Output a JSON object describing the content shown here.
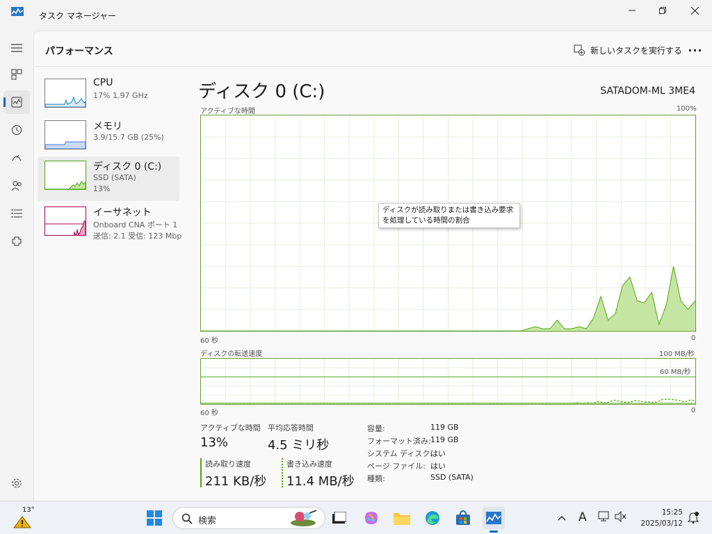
{
  "window": {
    "title": "タスク マネージャー",
    "controls": [
      "minimize",
      "restore",
      "close"
    ]
  },
  "header": {
    "page_title": "パフォーマンス",
    "run_task_label": "新しいタスクを実行する",
    "more_icon": "more-icon"
  },
  "nav": {
    "items": [
      "hamburger-icon",
      "processes-icon",
      "performance-icon",
      "app-history-icon",
      "startup-apps-icon",
      "users-icon",
      "details-icon",
      "services-icon"
    ],
    "settings": "settings-icon",
    "active": "performance-icon"
  },
  "resources": [
    {
      "name": "CPU",
      "line1": "17%  1.97 GHz",
      "line2": "",
      "color": "#117dbb"
    },
    {
      "name": "メモリ",
      "line1": "3.9/15.7 GB (25%)",
      "line2": "",
      "color": "#3c78d8"
    },
    {
      "name": "ディスク 0 (C:)",
      "line1": "SSD (SATA)",
      "line2": "13%",
      "color": "#4da60c"
    },
    {
      "name": "イーサネット",
      "line1": "Onboard CNA ポート 1",
      "line2": "送信: 2.1  受信: 123 Mbp",
      "color": "#a7004e"
    }
  ],
  "disk": {
    "title": "ディスク 0 (C:)",
    "model": "SATADOM-ML 3ME4",
    "active_graph": {
      "label": "アクティブな時間",
      "max_label": "100%",
      "time_left": "60 秒",
      "time_right": "0",
      "values_percent": [
        0,
        0,
        0,
        0,
        0,
        0,
        0,
        0,
        0,
        0,
        0,
        0,
        0,
        0,
        0,
        0,
        0,
        0,
        0,
        0,
        0,
        0,
        0,
        0,
        0,
        0,
        0,
        0,
        0,
        0,
        0,
        0,
        0,
        0,
        0,
        0,
        0,
        0,
        0,
        0,
        0,
        0,
        0,
        0,
        0,
        1,
        2,
        1,
        1,
        5,
        1,
        1,
        2,
        1,
        6,
        16,
        5,
        8,
        21,
        25,
        14,
        13,
        18,
        3,
        12,
        30,
        14,
        10,
        14
      ],
      "tooltip": "ディスクが読み取りまたは書き込み要求を処理している時間の割合"
    },
    "transfer_graph": {
      "label": "ディスクの転送速度",
      "max_label": "100 MB/秒",
      "ref_label": "60 MB/秒",
      "time_left": "60 秒",
      "time_right": "0",
      "read_values_mbps": [
        0,
        0,
        0,
        0,
        0,
        0,
        0,
        0,
        0,
        0,
        0,
        0,
        0,
        0,
        0,
        0,
        0,
        0,
        0,
        0,
        0,
        0,
        0,
        0,
        0,
        0,
        0,
        0,
        0,
        0,
        0,
        0,
        0,
        0,
        0,
        0,
        0,
        0,
        0,
        0,
        0,
        0,
        0,
        0,
        0,
        0,
        0,
        0,
        0,
        0,
        0,
        0,
        0,
        0,
        0,
        0,
        0,
        0,
        0,
        0,
        0,
        0,
        0,
        0,
        0,
        0,
        0,
        0,
        0,
        0,
        0,
        0,
        0,
        0,
        0,
        0,
        0,
        0,
        0,
        0,
        0,
        0,
        0,
        0,
        0,
        0,
        0,
        0,
        0,
        0,
        0,
        0,
        0
      ],
      "write_values_mbps": [
        0,
        0,
        0,
        0,
        0,
        0,
        0,
        0,
        0,
        0,
        0,
        0,
        0,
        0,
        0,
        0,
        0,
        0,
        0,
        0,
        0,
        0,
        0,
        0,
        0,
        0,
        0,
        0,
        0,
        0,
        0,
        0,
        0,
        0,
        0,
        0,
        0,
        0,
        0,
        0,
        0,
        0,
        0,
        0,
        0,
        0,
        0,
        0,
        0,
        0,
        0,
        0,
        0,
        0,
        0,
        0,
        0,
        0,
        0,
        0,
        0,
        0,
        0,
        0,
        0,
        0,
        0,
        0,
        0,
        0,
        1,
        0,
        1,
        0,
        4,
        1,
        3,
        7,
        4,
        2,
        3,
        6,
        4,
        3,
        2,
        3,
        9,
        9,
        8,
        6,
        3,
        7,
        6
      ]
    },
    "stats": {
      "active_time_label": "アクティブな時間",
      "active_time_value": "13%",
      "response_label": "平均応答時間",
      "response_value": "4.5 ミリ秒",
      "read_label": "読み取り速度",
      "read_value": "211 KB/秒",
      "write_label": "書き込み速度",
      "write_value": "11.4 MB/秒"
    },
    "info": [
      {
        "key": "容量:",
        "value": "119 GB"
      },
      {
        "key": "フォーマット済み:",
        "value": "119 GB"
      },
      {
        "key": "システム ディスク:",
        "value": "はい"
      },
      {
        "key": "ページ ファイル:",
        "value": "はい"
      },
      {
        "key": "種類:",
        "value": "SSD (SATA)"
      }
    ]
  },
  "taskbar": {
    "weather_temp": "13°",
    "search_placeholder": "検索",
    "time": "15:25",
    "date": "2025/03/12",
    "ime": "A",
    "apps": [
      "start-icon",
      "file-explorer-icon",
      "copilot-icon",
      "folder-icon",
      "edge-icon",
      "store-icon",
      "task-manager-icon"
    ]
  },
  "colors": {
    "disk_line": "#4da60c",
    "disk_fill": "#c5e6a3",
    "disk_border": "#6d9b3a",
    "cpu": "#117dbb",
    "memory": "#3c78d8",
    "ethernet": "#a7004e",
    "accent": "#0067c0"
  }
}
